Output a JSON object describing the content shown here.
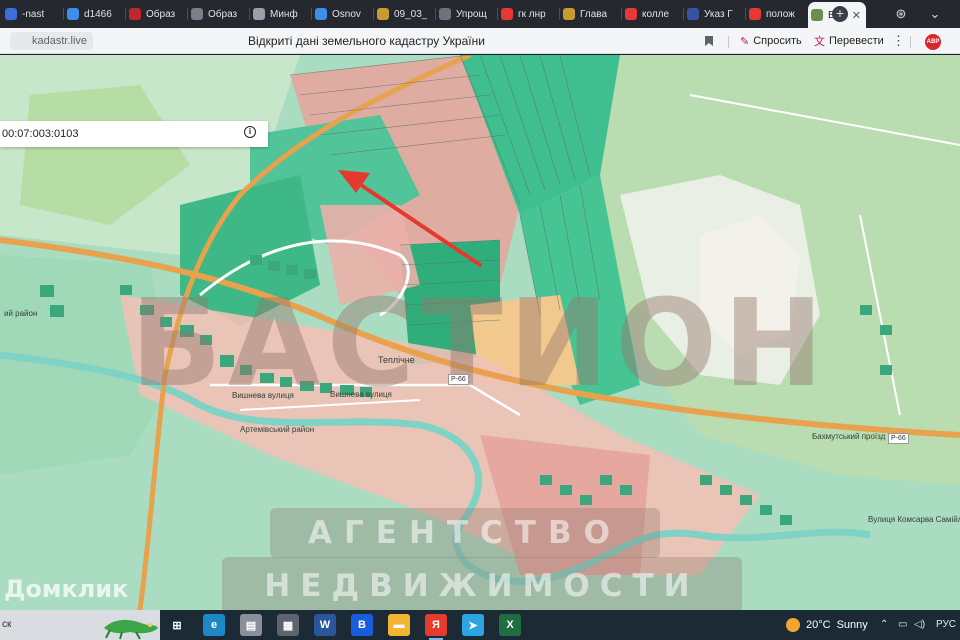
{
  "browser": {
    "tabs": [
      {
        "label": "-nast",
        "icon": "page-icon",
        "color": "#3c6fd8"
      },
      {
        "label": "d1466",
        "icon": "doc-icon",
        "color": "#3c8ee8"
      },
      {
        "label": "Образ",
        "icon": "image-icon",
        "color": "#c0262e"
      },
      {
        "label": "Образ",
        "icon": "at-icon",
        "color": "#7a7e87"
      },
      {
        "label": "Минф",
        "icon": "v-icon",
        "color": "#9aa0aa"
      },
      {
        "label": "Osnov",
        "icon": "doc-icon",
        "color": "#3c8ee8"
      },
      {
        "label": "09_03_",
        "icon": "emblem-icon",
        "color": "#c79b2e"
      },
      {
        "label": "Упрощ",
        "icon": "page-icon",
        "color": "#6d737e"
      },
      {
        "label": "гк лнр",
        "icon": "yandex-icon",
        "color": "#e53935"
      },
      {
        "label": "Глава",
        "icon": "emblem-icon",
        "color": "#c79b2e"
      },
      {
        "label": "колле",
        "icon": "yandex-icon",
        "color": "#e53935"
      },
      {
        "label": "Указ Г",
        "icon": "flag-icon",
        "color": "#3953a4"
      },
      {
        "label": "полож",
        "icon": "yandex-icon",
        "color": "#e53935"
      },
      {
        "label": "Від",
        "icon": "map-icon",
        "color": "#6b8e4e",
        "active": true
      }
    ],
    "url": "kadastr.live",
    "page_title": "Відкриті дані земельного кадастру України",
    "ask_label": "Спросить",
    "translate_label": "Перевести",
    "adblock_label": "ABP"
  },
  "map": {
    "search_value": "00:07:003:0103",
    "labels": {
      "village": "Теплічне",
      "road_bakhmut": "Бахмутський проїзд",
      "route": "Р-66",
      "street1": "Вишнева вулиця",
      "street2": "Вишнева вулиця",
      "district": "Артемівський район",
      "district2": "ий район",
      "street3": "Вулиця Комсарва Самійл"
    },
    "watermark": {
      "title": "БАСТИОН",
      "line1": "АГЕНТСТВО",
      "line2": "НЕДВИЖИМОСТИ",
      "source": "Домклик"
    },
    "colors": {
      "parcel": "#3fbf8f",
      "road": "#e8a24d",
      "arrow": "#e5392f",
      "forest": "#b9ddb0"
    }
  },
  "taskbar": {
    "search_text": "ск",
    "apps": [
      {
        "name": "task-view",
        "glyph": "⊞",
        "color": "#1c2a36"
      },
      {
        "name": "edge",
        "glyph": "e",
        "color": "#1e88c7"
      },
      {
        "name": "files",
        "glyph": "▤",
        "color": "#8a8f99"
      },
      {
        "name": "calculator",
        "glyph": "▦",
        "color": "#5d6470"
      },
      {
        "name": "word",
        "glyph": "W",
        "color": "#2b579a"
      },
      {
        "name": "bitwarden",
        "glyph": "B",
        "color": "#175ddc"
      },
      {
        "name": "explorer",
        "glyph": "▬",
        "color": "#f2b634"
      },
      {
        "name": "yandex",
        "glyph": "Я",
        "color": "#e63a2e",
        "active": true
      },
      {
        "name": "telegram",
        "glyph": "➤",
        "color": "#2ca5e0"
      },
      {
        "name": "excel",
        "glyph": "X",
        "color": "#1d6f42"
      }
    ],
    "weather": {
      "temp": "20°C",
      "condition": "Sunny"
    },
    "language": "РУС"
  }
}
